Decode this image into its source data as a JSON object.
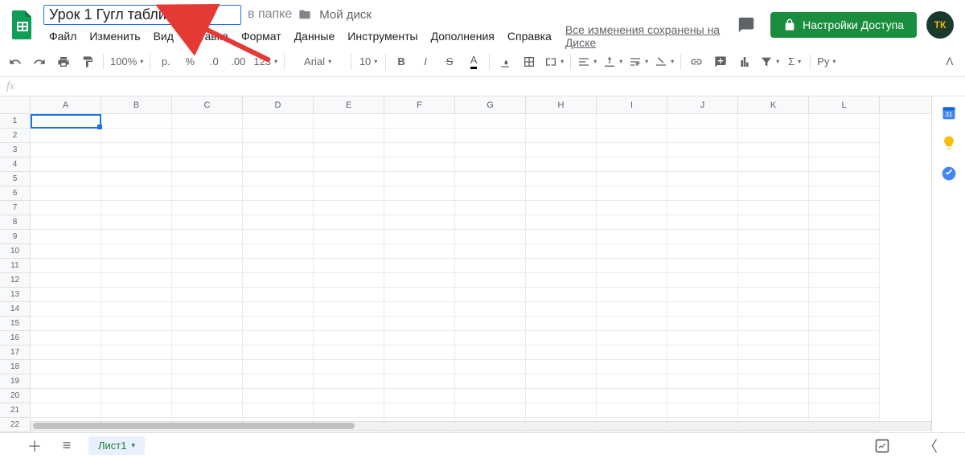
{
  "header": {
    "doc_title": "Урок 1 Гугл таблиц.",
    "folder_prefix": "в папке",
    "folder_name": "Мой диск",
    "share_label": "Настройки Доступа",
    "avatar_initials": "ТК"
  },
  "menus": [
    "Файл",
    "Изменить",
    "Вид",
    "Вставка",
    "Формат",
    "Данные",
    "Инструменты",
    "Дополнения",
    "Справка"
  ],
  "saved_text": "Все изменения сохранены на Диске",
  "toolbar": {
    "zoom": "100%",
    "currency": "р.",
    "percent": "%",
    "dec_less": ".0",
    "dec_more": ".00",
    "format": "123",
    "font": "Arial",
    "font_size": "10",
    "lang": "Ру"
  },
  "columns": [
    "A",
    "B",
    "C",
    "D",
    "E",
    "F",
    "G",
    "H",
    "I",
    "J",
    "K",
    "L"
  ],
  "rows": [
    "1",
    "2",
    "3",
    "4",
    "5",
    "6",
    "7",
    "8",
    "9",
    "10",
    "11",
    "12",
    "13",
    "14",
    "15",
    "16",
    "17",
    "18",
    "19",
    "20",
    "21",
    "22"
  ],
  "sheet_tab": "Лист1",
  "fx": "fx"
}
